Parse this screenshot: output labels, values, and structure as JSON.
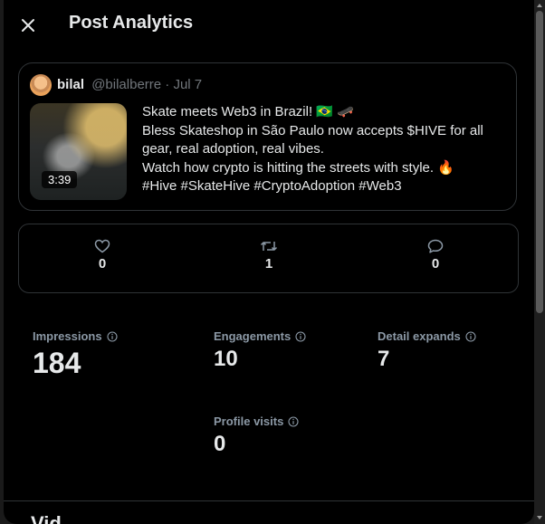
{
  "header": {
    "title": "Post Analytics",
    "close_icon": "close-icon"
  },
  "post": {
    "author_name": "bilal",
    "author_handle": "@bilalberre · Jul 7",
    "video_duration": "3:39",
    "text_lines": [
      "Skate meets Web3 in Brazil! 🇧🇷 🛹",
      "Bless Skateshop in São Paulo now accepts $HIVE for all",
      "gear, real adoption, real vibes.",
      "Watch how crypto is hitting the streets with style. 🔥",
      "#Hive #SkateHive #CryptoAdoption #Web3"
    ]
  },
  "counts": {
    "likes": "0",
    "reposts": "1",
    "replies": "0"
  },
  "metrics": {
    "impressions": {
      "label": "Impressions",
      "value": "184"
    },
    "engagements": {
      "label": "Engagements",
      "value": "10"
    },
    "detail_expands": {
      "label": "Detail expands",
      "value": "7"
    },
    "profile_visits": {
      "label": "Profile visits",
      "value": "0"
    }
  },
  "bottom": {
    "partial_heading": "Vid"
  },
  "colors": {
    "background": "#000000",
    "border": "#2f3336",
    "text_primary": "#e7e9ea",
    "text_secondary": "#71767b"
  }
}
